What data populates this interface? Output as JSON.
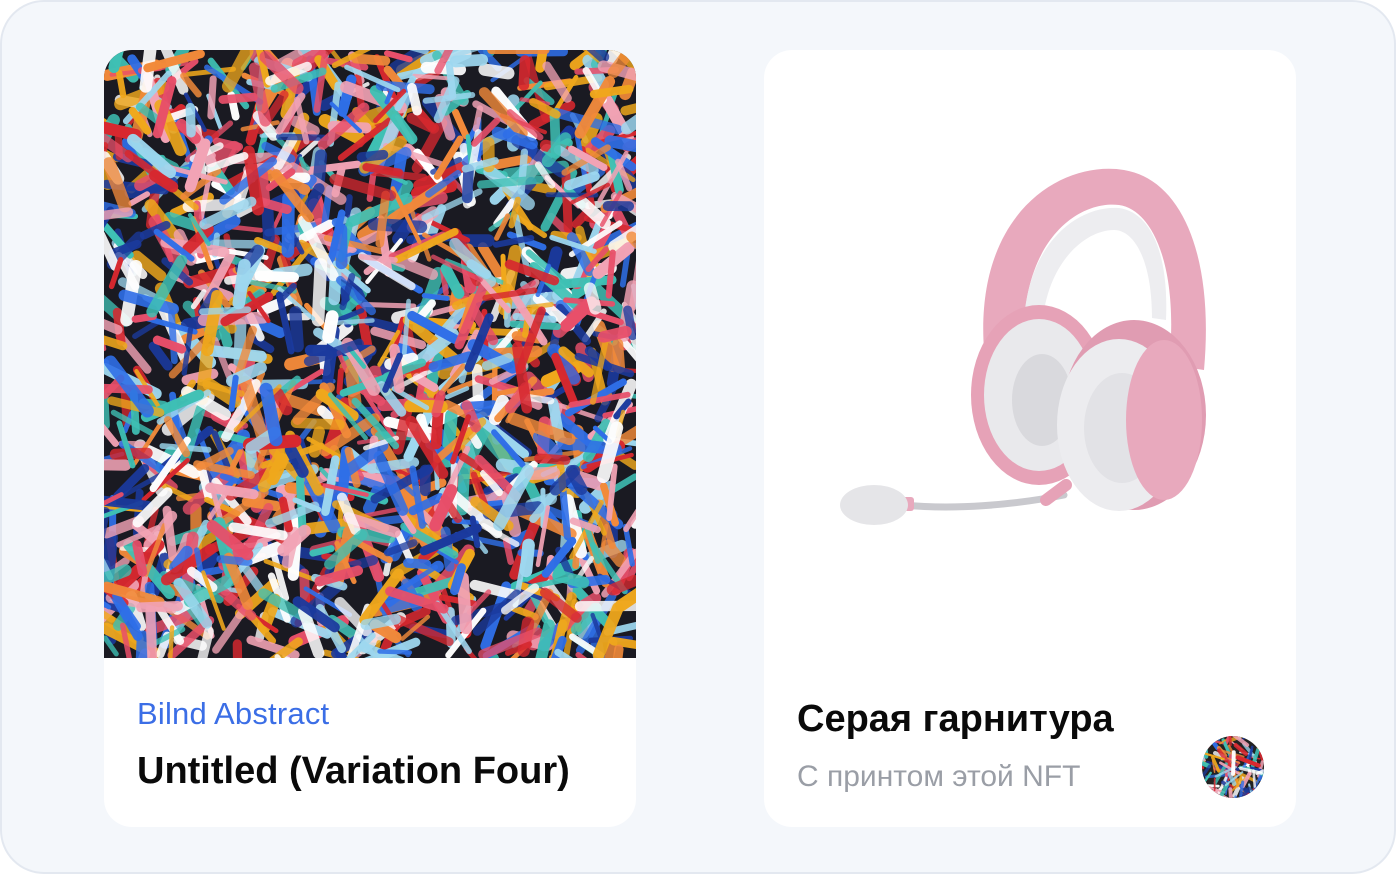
{
  "nft_card": {
    "artist": "Bilnd Abstract",
    "title": "Untitled (Variation Four)",
    "artwork_palette": [
      "#f0a81c",
      "#2f6fe8",
      "#e84f6a",
      "#f2a3b5",
      "#3fc1b5",
      "#ffffff",
      "#d7282f",
      "#1b3a9e",
      "#f28a3a",
      "#9ed8f0"
    ]
  },
  "product_card": {
    "name": "Серая гарнитура",
    "subtitle": "С принтом этой NFT",
    "image_icon": "headset-icon",
    "colors": {
      "headband": "#e8a9bd",
      "cushion": "#ececee",
      "accent": "#d98aa4"
    }
  }
}
